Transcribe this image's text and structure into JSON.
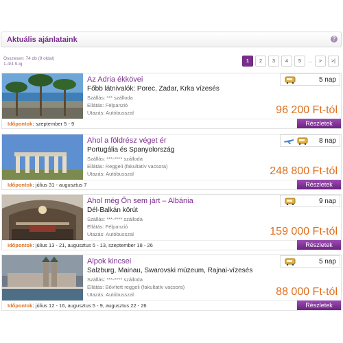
{
  "header": {
    "title": "Aktuális ajánlataink",
    "help_icon": "?"
  },
  "summary": {
    "line1": "Összesen: 74 db (9 oldal)",
    "line2": "1-4/4 9-ig"
  },
  "pager": {
    "pages": [
      "1",
      "2",
      "3",
      "4",
      "5"
    ],
    "ellipsis": "...",
    "next": ">",
    "last": ">|",
    "active": "1"
  },
  "dates_label": "Időpontok:",
  "details_label": "Részletek",
  "tours": [
    {
      "title": "Az Adria ékkövei",
      "subtitle": "Főbb látnivalók: Porec, Zadar, Krka vízesés",
      "lodging": "Szállás: *** szálloda",
      "board": "Ellátás: Félpanzió",
      "travel": "Utazás: Autóbusszal",
      "days": "5 nap",
      "price": "96 200 Ft-tól",
      "dates": "szeptember 5 - 9",
      "icons": [
        "bus-icon"
      ]
    },
    {
      "title": "Ahol a földrész véget ér",
      "subtitle": "Portugália és Spanyolország",
      "lodging": "Szállás: ***-**** szálloda",
      "board": "Ellátás: Reggeli (fakultatív vacsora)",
      "travel": "Utazás: Autóbusszal",
      "days": "8 nap",
      "price": "248 800 Ft-tól",
      "dates": "július 31 - augusztus 7",
      "icons": [
        "plane-icon",
        "bus-icon"
      ]
    },
    {
      "title": "Ahol még Ön sem járt – Albánia",
      "subtitle": "Dél-Balkán körút",
      "lodging": "Szállás: ***-**** szálloda",
      "board": "Ellátás: Félpanzió",
      "travel": "Utazás: Autóbusszal",
      "days": "9 nap",
      "price": "159 000 Ft-tól",
      "dates": "július 13 - 21, augusztus 5 - 13, szeptember 18 - 26",
      "icons": [
        "bus-icon"
      ]
    },
    {
      "title": "Alpok kincsei",
      "subtitle": "Salzburg, Mainau, Swarovski múzeum, Rajnai-vízesés",
      "lodging": "Szállás: ***-**** szálloda",
      "board": "Ellátás: Bővített reggeli (fakultatív vacsora)",
      "travel": "Utazás: Autóbusszal",
      "days": "5 nap",
      "price": "88 000 Ft-tól",
      "dates": "július 12 - 16, augusztus 5 - 9, augusztus 22 - 26",
      "icons": [
        "bus-icon"
      ]
    }
  ]
}
